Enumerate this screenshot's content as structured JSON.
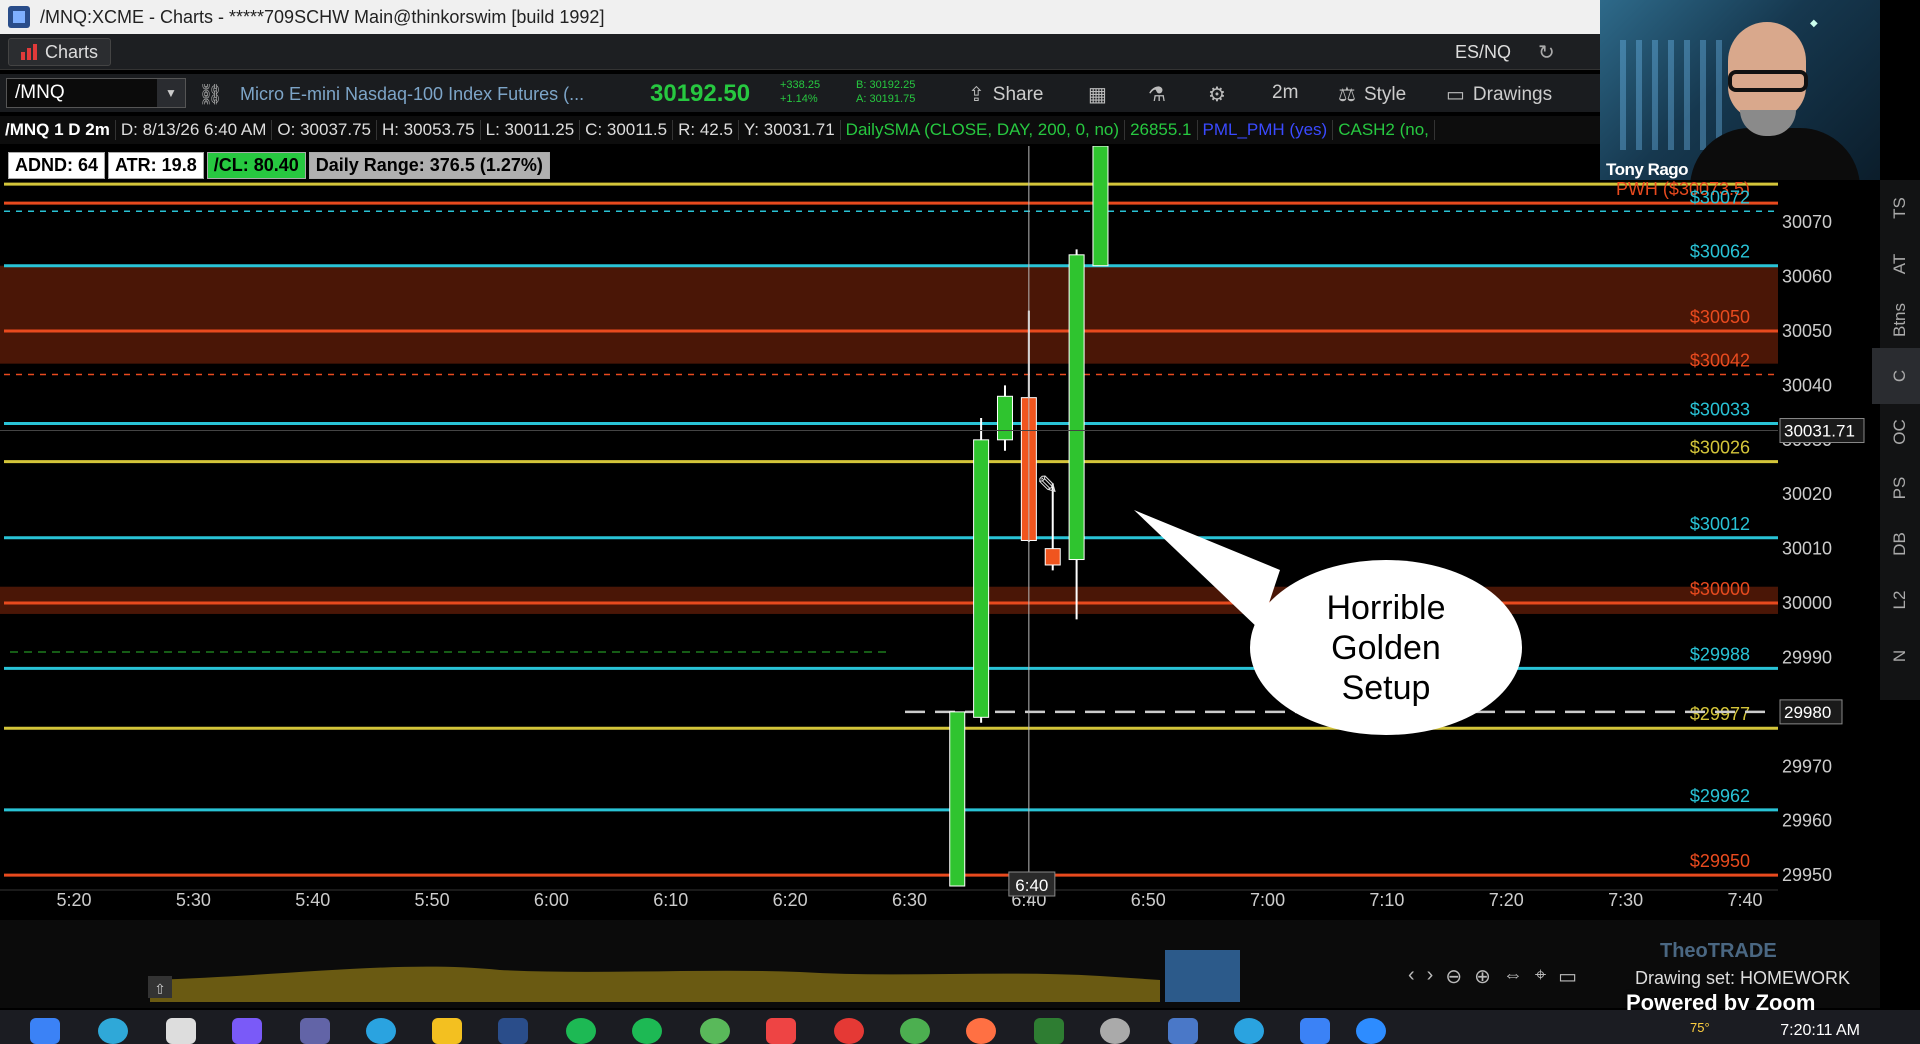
{
  "window": {
    "title": "/MNQ:XCME - Charts - *****709SCHW Main@thinkorswim [build 1992]"
  },
  "menu": {
    "charts_tab": "Charts",
    "pair": "ES/NQ"
  },
  "toolbar": {
    "symbol": "/MNQ",
    "description": "Micro E-mini Nasdaq-100 Index Futures (...",
    "last_price": "30192.50",
    "change_top": "+338.25",
    "change_bottom": "+1.14%",
    "bid": "B: 30192.25",
    "ask": "A: 30191.75",
    "share": "Share",
    "timeframe": "2m",
    "style": "Style",
    "drawings": "Drawings"
  },
  "info": {
    "symbol_period": "/MNQ 1 D 2m",
    "date": "D: 8/13/26 6:40 AM",
    "open": "O: 30037.75",
    "high": "H: 30053.75",
    "low": "L: 30011.25",
    "close": "C: 30011.5",
    "range": "R: 42.5",
    "y": "Y: 30031.71",
    "sma": "DailySMA (CLOSE, DAY, 200, 0, no)",
    "sma_value": "26855.1",
    "pml": "PML_PMH (yes)",
    "cash": "CASH2 (no,"
  },
  "studies": {
    "adnd": "ADND: 64",
    "atr": "ATR: 19.8",
    "cl": "/CL: 80.40",
    "daily_range": "Daily Range: 376.5 (1.27%)"
  },
  "side_tabs": [
    "TS",
    "AT",
    "Btns",
    "C",
    "OC",
    "PS",
    "DB",
    "L2",
    "N"
  ],
  "webcam": {
    "name": "Tony Rago"
  },
  "callout": {
    "line1": "Horrible",
    "line2": "Golden",
    "line3": "Setup"
  },
  "footer": {
    "drawing_set": "Drawing set: HOMEWORK",
    "powered": "Powered by Zoom",
    "watermark": "TheoTRADE"
  },
  "taskbar": {
    "temperature": "75°",
    "time": "7:20:11 AM"
  },
  "colors": {
    "cyan": "#29c3d6",
    "yellow": "#d4c53a",
    "red": "#e84a1e",
    "up": "#2fc42f",
    "down": "#f0551e"
  },
  "chart_data": {
    "type": "candlestick",
    "y_range": [
      29948,
      30084
    ],
    "x_labels": [
      "5:20",
      "5:30",
      "5:40",
      "5:50",
      "6:00",
      "6:10",
      "6:20",
      "6:30",
      "6:40",
      "6:50",
      "7:00",
      "7:10",
      "7:20",
      "7:30",
      "7:40"
    ],
    "y_ticks": [
      30080,
      30070,
      30060,
      30050,
      30040,
      30030,
      30020,
      30010,
      30000,
      29990,
      29980,
      29970,
      29960,
      29950
    ],
    "crosshair_y_label": "30031.71",
    "crosshair_x_label": "6:40",
    "dashed_level_label": "29980",
    "levels": [
      {
        "value": 30077,
        "label": "$30077",
        "color": "yellow"
      },
      {
        "value": 30073.5,
        "label": "PWH ($30073.5)",
        "color": "red"
      },
      {
        "value": 30072,
        "label": "$30072",
        "color": "cyan",
        "dashed": true
      },
      {
        "value": 30062,
        "label": "$30062",
        "color": "cyan"
      },
      {
        "value": 30050,
        "label": "$30050",
        "color": "red"
      },
      {
        "value": 30042,
        "label": "$30042",
        "color": "red",
        "dashed": true
      },
      {
        "value": 30033,
        "label": "$30033",
        "color": "cyan"
      },
      {
        "value": 30026,
        "label": "$30026",
        "color": "yellow"
      },
      {
        "value": 30012,
        "label": "$30012",
        "color": "cyan"
      },
      {
        "value": 30000,
        "label": "$30000",
        "color": "red"
      },
      {
        "value": 29988,
        "label": "$29988",
        "color": "cyan"
      },
      {
        "value": 29977,
        "label": "$29977",
        "color": "yellow"
      },
      {
        "value": 29962,
        "label": "$29962",
        "color": "cyan"
      },
      {
        "value": 29950,
        "label": "$29950",
        "color": "red"
      }
    ],
    "candles": [
      {
        "t": "6:34",
        "o": 29948,
        "h": 29980,
        "l": 29948,
        "c": 29980
      },
      {
        "t": "6:36",
        "o": 29979,
        "h": 30034,
        "l": 29978,
        "c": 30030
      },
      {
        "t": "6:38",
        "o": 30030,
        "h": 30040,
        "l": 30028,
        "c": 30038
      },
      {
        "t": "6:40",
        "o": 30037.75,
        "h": 30053.75,
        "l": 30011.25,
        "c": 30011.5
      },
      {
        "t": "6:42",
        "o": 30010,
        "h": 30022,
        "l": 30006,
        "c": 30007
      },
      {
        "t": "6:44",
        "o": 30008,
        "h": 30065,
        "l": 29997,
        "c": 30064
      },
      {
        "t": "6:46",
        "o": 30062,
        "h": 30084,
        "l": 30062,
        "c": 30084
      }
    ]
  }
}
